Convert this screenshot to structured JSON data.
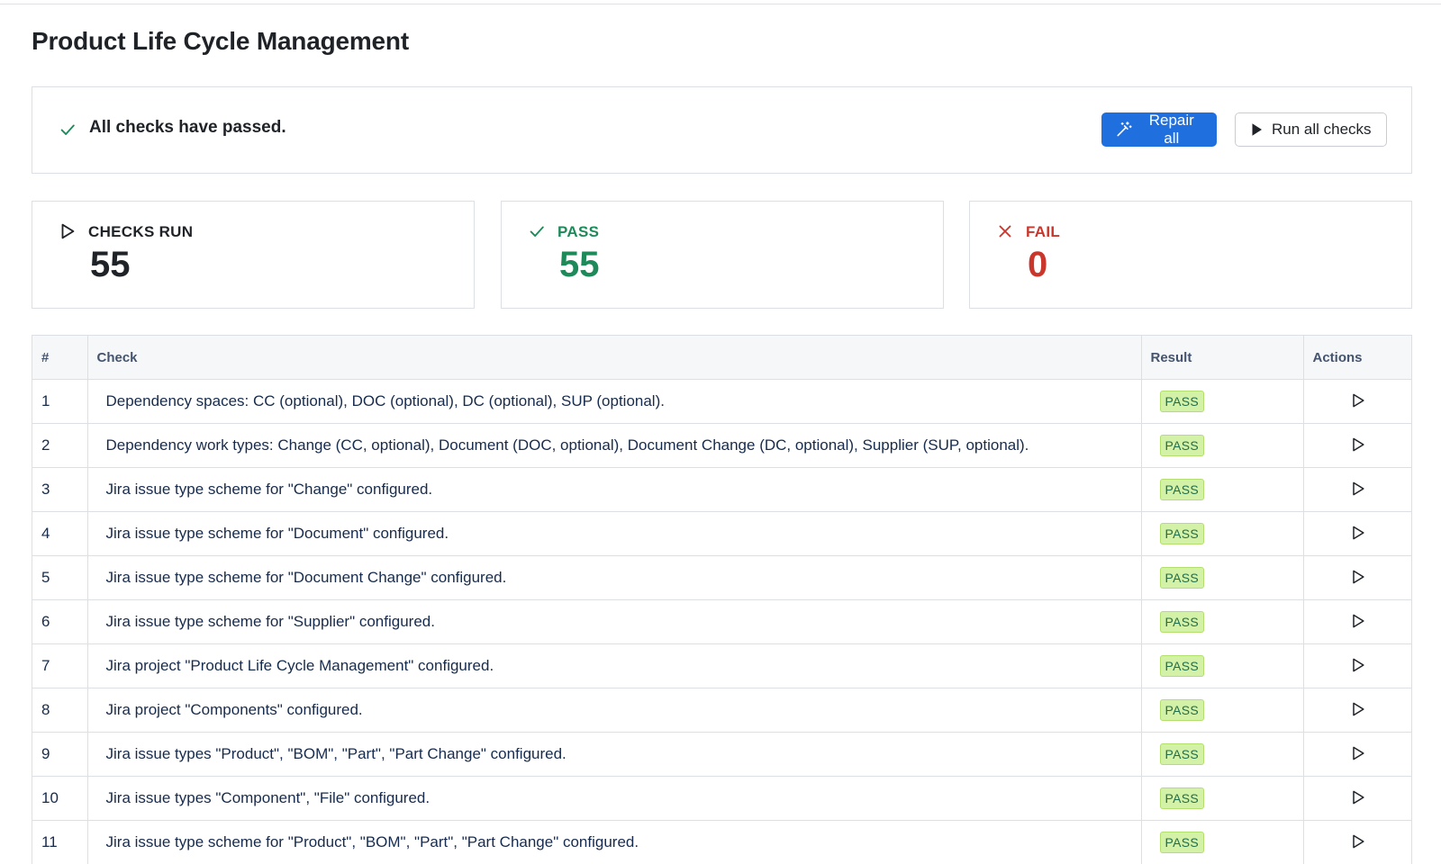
{
  "page": {
    "title": "Product Life Cycle Management"
  },
  "status": {
    "message": "All checks have passed.",
    "icon": "check-icon",
    "repair_label": "Repair all",
    "repair_icon": "magic-wand-icon",
    "run_label": "Run all checks",
    "run_icon": "play-filled-icon"
  },
  "stats": {
    "checks_run": {
      "label": "CHECKS RUN",
      "value": "55",
      "icon": "play-outline-icon",
      "color": "#1f2328"
    },
    "pass": {
      "label": "PASS",
      "value": "55",
      "icon": "check-icon",
      "color": "#1e8a5a"
    },
    "fail": {
      "label": "FAIL",
      "value": "0",
      "icon": "x-icon",
      "color": "#c9372c"
    }
  },
  "table": {
    "headers": {
      "num": "#",
      "check": "Check",
      "result": "Result",
      "actions": "Actions"
    },
    "rows": [
      {
        "num": "1",
        "check": "Dependency spaces: CC (optional), DOC (optional), DC (optional), SUP (optional).",
        "result": "PASS"
      },
      {
        "num": "2",
        "check": "Dependency work types: Change (CC, optional), Document (DOC, optional), Document Change (DC, optional), Supplier (SUP, optional).",
        "result": "PASS"
      },
      {
        "num": "3",
        "check": "Jira issue type scheme for \"Change\" configured.",
        "result": "PASS"
      },
      {
        "num": "4",
        "check": "Jira issue type scheme for \"Document\" configured.",
        "result": "PASS"
      },
      {
        "num": "5",
        "check": "Jira issue type scheme for \"Document Change\" configured.",
        "result": "PASS"
      },
      {
        "num": "6",
        "check": "Jira issue type scheme for \"Supplier\" configured.",
        "result": "PASS"
      },
      {
        "num": "7",
        "check": "Jira project \"Product Life Cycle Management\" configured.",
        "result": "PASS"
      },
      {
        "num": "8",
        "check": "Jira project \"Components\" configured.",
        "result": "PASS"
      },
      {
        "num": "9",
        "check": "Jira issue types \"Product\", \"BOM\", \"Part\", \"Part Change\" configured.",
        "result": "PASS"
      },
      {
        "num": "10",
        "check": "Jira issue types \"Component\", \"File\" configured.",
        "result": "PASS"
      },
      {
        "num": "11",
        "check": "Jira issue type scheme for \"Product\", \"BOM\", \"Part\", \"Part Change\" configured.",
        "result": "PASS"
      }
    ]
  },
  "colors": {
    "primary": "#1f6fde",
    "pass_badge_bg": "#d3f1a7",
    "pass_text": "#1e8a5a",
    "fail_text": "#c9372c"
  }
}
